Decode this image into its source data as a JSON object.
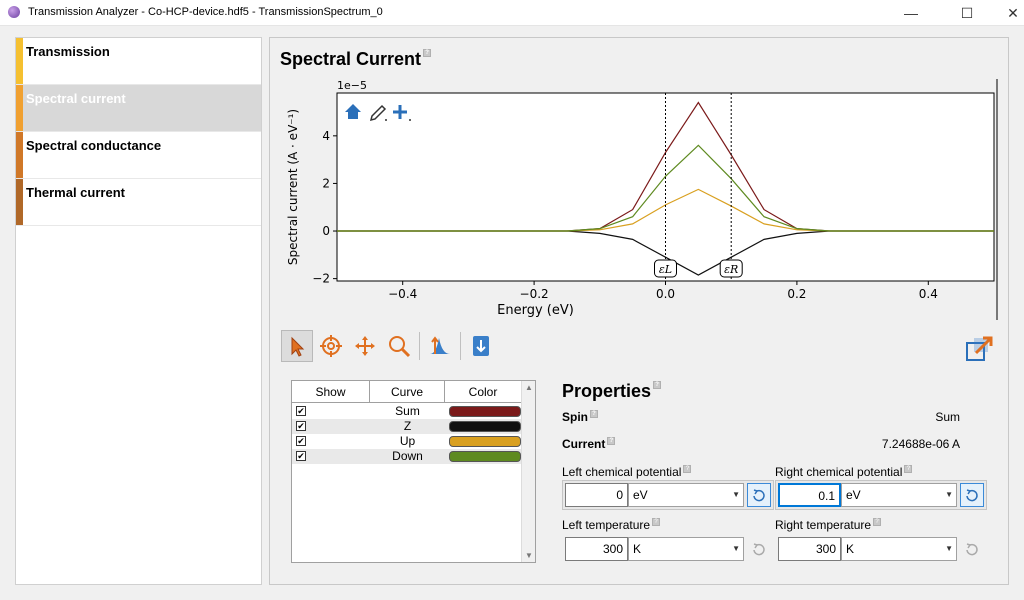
{
  "window": {
    "title": "Transmission Analyzer - Co-HCP-device.hdf5 - TransmissionSpectrum_0",
    "minimize": "—",
    "maximize": "☐",
    "close": "✕"
  },
  "sidebar": {
    "items": [
      {
        "label": "Transmission",
        "color": "#f5c030"
      },
      {
        "label": "Spectral current",
        "color": "#f0a030"
      },
      {
        "label": "Spectral conductance",
        "color": "#d07828"
      },
      {
        "label": "Thermal current",
        "color": "#b06828"
      }
    ]
  },
  "main": {
    "title": "Spectral Current"
  },
  "chart_data": {
    "type": "line",
    "title": "",
    "xlabel": "Energy (eV)",
    "ylabel": "Spectral current (A · eV⁻¹)",
    "y_multiplier": "1e−5",
    "xlim": [
      -0.5,
      0.5
    ],
    "ylim": [
      -2.1,
      5.8
    ],
    "xticks": [
      -0.4,
      -0.2,
      0.0,
      0.2,
      0.4
    ],
    "xtick_labels": [
      "−0.4",
      "−0.2",
      "0.0",
      "0.2",
      "0.4"
    ],
    "yticks": [
      -2,
      0,
      2,
      4
    ],
    "ytick_labels": [
      "−2",
      "0",
      "2",
      "4"
    ],
    "grid": false,
    "x": [
      -0.5,
      -0.15,
      -0.1,
      -0.05,
      0.0,
      0.05,
      0.1,
      0.15,
      0.2,
      0.25,
      0.5
    ],
    "series": [
      {
        "name": "Sum",
        "color": "#7b1a1a",
        "values": [
          0,
          0,
          0.1,
          0.9,
          3.3,
          5.4,
          3.2,
          0.9,
          0.1,
          0,
          0
        ]
      },
      {
        "name": "Z",
        "color": "#111111",
        "values": [
          0,
          0,
          -0.1,
          -0.35,
          -1.1,
          -1.85,
          -1.1,
          -0.35,
          -0.1,
          0,
          0
        ]
      },
      {
        "name": "Up",
        "color": "#d9a020",
        "values": [
          0,
          0,
          0.05,
          0.3,
          1.1,
          1.75,
          1.05,
          0.3,
          0.05,
          0,
          0
        ]
      },
      {
        "name": "Down",
        "color": "#5e8a20",
        "values": [
          0,
          0,
          0.1,
          0.6,
          2.3,
          3.6,
          2.2,
          0.6,
          0.1,
          0,
          0
        ]
      }
    ],
    "vlines": [
      {
        "x": 0.0,
        "label": "εL"
      },
      {
        "x": 0.1,
        "label": "εR"
      }
    ]
  },
  "curves_table": {
    "headers": [
      "Show",
      "Curve",
      "Color"
    ],
    "rows": [
      {
        "show": true,
        "curve": "Sum",
        "color": "#7b1a1a"
      },
      {
        "show": true,
        "curve": "Z",
        "color": "#111111"
      },
      {
        "show": true,
        "curve": "Up",
        "color": "#d9a020"
      },
      {
        "show": true,
        "curve": "Down",
        "color": "#5e8a20"
      }
    ],
    "check_glyph": "✔"
  },
  "properties": {
    "title": "Properties",
    "spin_label": "Spin",
    "spin_value": "Sum",
    "current_label": "Current",
    "current_value": "7.24688e-06 A",
    "left_mu_label": "Left chemical potential",
    "left_mu_value": "0",
    "left_mu_unit": "eV",
    "right_mu_label": "Right chemical potential",
    "right_mu_value": "0.1",
    "right_mu_unit": "eV",
    "left_t_label": "Left temperature",
    "left_t_value": "300",
    "left_t_unit": "K",
    "right_t_label": "Right temperature",
    "right_t_value": "300",
    "right_t_unit": "K"
  },
  "icons": {
    "home": "home-icon",
    "pencil": "pencil-icon",
    "crosshair_add": "add-icon"
  }
}
